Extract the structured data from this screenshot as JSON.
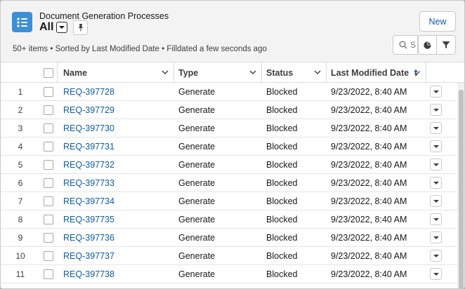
{
  "header": {
    "object_title": "Document Generation Processes",
    "view_name": "All",
    "new_label": "New",
    "meta": "50+ items • Sorted by Last Modified Date • Filldated a few seconds ago",
    "search_partial": "S",
    "icon_color": "#3d8fd6"
  },
  "table": {
    "columns": {
      "name": "Name",
      "type": "Type",
      "status": "Status",
      "date": "Last Modified Date"
    },
    "sort": {
      "column": "date",
      "direction": "ascending"
    },
    "rows": [
      {
        "n": "1",
        "name": "REQ-397728",
        "type": "Generate",
        "status": "Blocked",
        "date": "9/23/2022, 8:40 AM"
      },
      {
        "n": "2",
        "name": "REQ-397729",
        "type": "Generate",
        "status": "Blocked",
        "date": "9/23/2022, 8:40 AM"
      },
      {
        "n": "3",
        "name": "REQ-397730",
        "type": "Generate",
        "status": "Blocked",
        "date": "9/23/2022, 8:40 AM"
      },
      {
        "n": "4",
        "name": "REQ-397731",
        "type": "Generate",
        "status": "Blocked",
        "date": "9/23/2022, 8:40 AM"
      },
      {
        "n": "5",
        "name": "REQ-397732",
        "type": "Generate",
        "status": "Blocked",
        "date": "9/23/2022, 8:40 AM"
      },
      {
        "n": "6",
        "name": "REQ-397733",
        "type": "Generate",
        "status": "Blocked",
        "date": "9/23/2022, 8:40 AM"
      },
      {
        "n": "7",
        "name": "REQ-397734",
        "type": "Generate",
        "status": "Blocked",
        "date": "9/23/2022, 8:40 AM"
      },
      {
        "n": "8",
        "name": "REQ-397735",
        "type": "Generate",
        "status": "Blocked",
        "date": "9/23/2022, 8:40 AM"
      },
      {
        "n": "9",
        "name": "REQ-397736",
        "type": "Generate",
        "status": "Blocked",
        "date": "9/23/2022, 8:40 AM"
      },
      {
        "n": "10",
        "name": "REQ-397737",
        "type": "Generate",
        "status": "Blocked",
        "date": "9/23/2022, 8:40 AM"
      },
      {
        "n": "11",
        "name": "REQ-397738",
        "type": "Generate",
        "status": "Blocked",
        "date": "9/23/2022, 8:40 AM"
      }
    ]
  },
  "colors": {
    "link": "#0b5cab",
    "brand_icon": "#3d8fd6",
    "border": "#dddbda"
  }
}
